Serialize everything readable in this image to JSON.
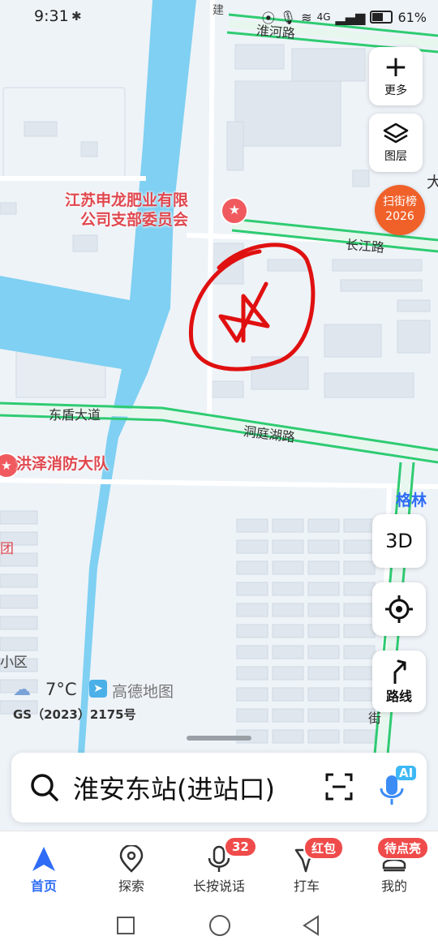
{
  "status_bar": {
    "time": "9:31",
    "battery": "61%",
    "network": "4G"
  },
  "map": {
    "roads": {
      "huaihe": "淮河路",
      "changjiang": "长江路",
      "dongdun": "东盾大道",
      "dongting": "洞庭湖路",
      "jian": "建",
      "jie": "街"
    },
    "pois": {
      "jiangsu_line1": "江苏申龙肥业有限",
      "jiangsu_line2": "公司支部委员会",
      "fire_station": "洪泽消防大队",
      "gelin": "格林",
      "tuan": "团",
      "xiaoqu": "小区",
      "da": "大"
    },
    "weather": "7°C",
    "brand": "高德地图",
    "license": "GS（2023）2175号",
    "promo_line1": "扫街榜",
    "promo_line2": "2026"
  },
  "controls": {
    "more_label": "更多",
    "layers_label": "图层",
    "threed_label": "3D",
    "route_label": "路线"
  },
  "search": {
    "value": "淮安东站(进站口)",
    "ai_badge": "AI"
  },
  "tabs": [
    {
      "label": "首页",
      "icon": "navigation-arrow-icon"
    },
    {
      "label": "探索",
      "icon": "location-pin-icon"
    },
    {
      "label": "长按说话",
      "icon": "microphone-icon",
      "badge": "32"
    },
    {
      "label": "打车",
      "icon": "taxi-flag-icon",
      "badge": "红包"
    },
    {
      "label": "我的",
      "icon": "profile-icon",
      "badge": "待点亮"
    }
  ],
  "colors": {
    "accent": "#2e6cf6",
    "badge": "#f04b4b",
    "river": "#7fd0f2",
    "road": "#2ecc71",
    "ink": "#e01010"
  }
}
